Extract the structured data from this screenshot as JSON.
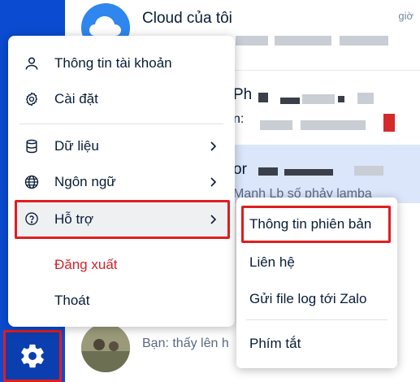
{
  "conversations": [
    {
      "title": "Cloud của tôi",
      "subtitle": "...",
      "time": "giờ"
    },
    {
      "title": "Ph",
      "subtitle": "n:"
    },
    {
      "title": "or",
      "subtitle": "Mạnh Lb số phảy lamba"
    },
    {
      "title": "",
      "subtitle": "Bạn: thấy lên h"
    }
  ],
  "menu": {
    "account": "Thông tin tài khoản",
    "settings": "Cài đặt",
    "data": "Dữ liệu",
    "language": "Ngôn ngữ",
    "support": "Hỗ trợ",
    "logout": "Đăng xuất",
    "quit": "Thoát"
  },
  "submenu": {
    "version": "Thông tin phiên bản",
    "contact": "Liên hệ",
    "send_log": "Gửi file log tới Zalo",
    "shortcuts": "Phím tắt"
  },
  "colors": {
    "rail": "#0b4bd1",
    "highlight_border": "#e01e1e",
    "danger_text": "#d0242b"
  },
  "icons": {
    "account": "user-icon",
    "settings": "gear-icon",
    "data": "database-icon",
    "language": "globe-icon",
    "support": "help-icon",
    "rail": "gear-icon"
  }
}
